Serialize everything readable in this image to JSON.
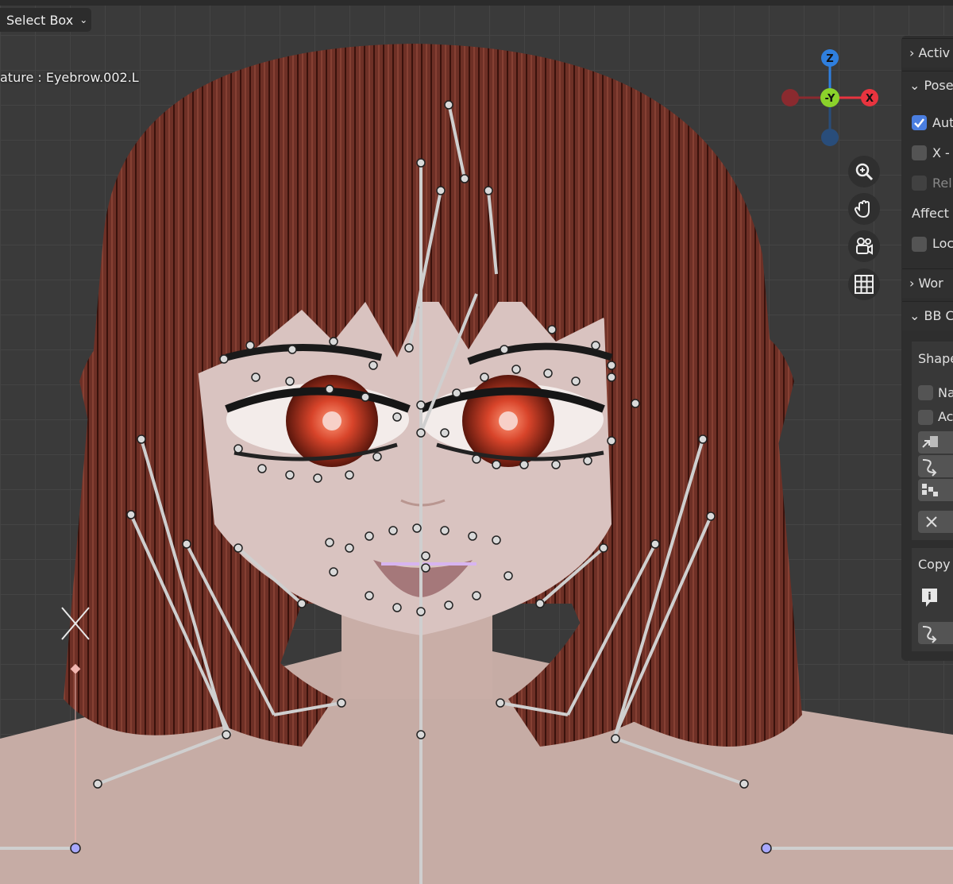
{
  "header": {
    "select_mode": "Select Box",
    "active_object": "ature : Eyebrow.002.L"
  },
  "gizmo": {
    "axes": [
      "Z",
      "-Y",
      "X"
    ],
    "colors": {
      "x": "#e8343f",
      "y": "#8bd22b",
      "z": "#2f7fde",
      "neg_x": "#8a2a2f",
      "neg_z": "#294d7a"
    }
  },
  "nav_buttons": [
    "zoom-icon",
    "hand-pan-icon",
    "camera-icon",
    "grid-icon"
  ],
  "sidebar": {
    "active_label": "Activ",
    "pose_label": "Pose",
    "auto_label": "Aut",
    "xaxis_label": "X - A",
    "relative_label": "Rel",
    "affect_label": "Affect",
    "local_label": "Loc",
    "world_label": "Wor",
    "bb_label": "BB C",
    "shape_label": "Shape",
    "na_label": "Na",
    "ac_label": "Ac",
    "copy_label": "Copy"
  }
}
